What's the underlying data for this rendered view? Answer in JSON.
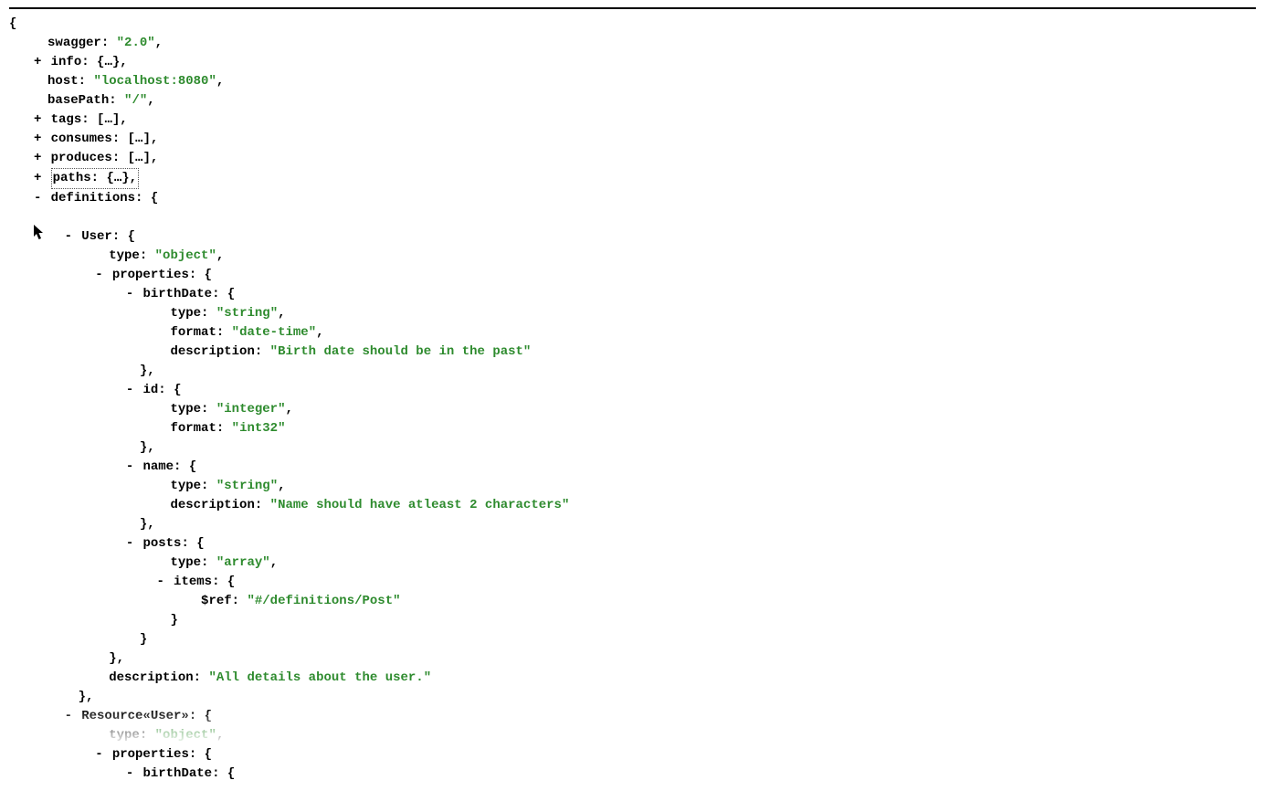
{
  "plus": "+",
  "minus": "-",
  "openBrace": "{",
  "closeBrace": "}",
  "collapsedObj": "{…}",
  "collapsedArr": "[…]",
  "comma": ",",
  "colon": ":",
  "quote": "\"",
  "root": {
    "swagger": {
      "key": "swagger",
      "value": "2.0"
    },
    "info": {
      "key": "info"
    },
    "host": {
      "key": "host",
      "value": "localhost:8080"
    },
    "basePath": {
      "key": "basePath",
      "value": "/"
    },
    "tags": {
      "key": "tags"
    },
    "consumes": {
      "key": "consumes"
    },
    "produces": {
      "key": "produces"
    },
    "paths": {
      "key": "paths"
    },
    "definitions": {
      "key": "definitions",
      "User": {
        "key": "User",
        "type": {
          "key": "type",
          "value": "object"
        },
        "properties": {
          "key": "properties",
          "birthDate": {
            "key": "birthDate",
            "type": {
              "key": "type",
              "value": "string"
            },
            "format": {
              "key": "format",
              "value": "date-time"
            },
            "description": {
              "key": "description",
              "value": "Birth date should be in the past"
            }
          },
          "id": {
            "key": "id",
            "type": {
              "key": "type",
              "value": "integer"
            },
            "format": {
              "key": "format",
              "value": "int32"
            }
          },
          "name": {
            "key": "name",
            "type": {
              "key": "type",
              "value": "string"
            },
            "description": {
              "key": "description",
              "value": "Name should have atleast 2 characters"
            }
          },
          "posts": {
            "key": "posts",
            "type": {
              "key": "type",
              "value": "array"
            },
            "items": {
              "key": "items",
              "ref": {
                "key": "$ref",
                "value": "#/definitions/Post"
              }
            }
          }
        },
        "description": {
          "key": "description",
          "value": "All details about the user."
        }
      },
      "ResourceUser": {
        "key": "Resource«User»",
        "type": {
          "key": "type",
          "value": "object"
        },
        "properties": {
          "key": "properties",
          "birthDate": {
            "key": "birthDate"
          }
        }
      }
    }
  }
}
